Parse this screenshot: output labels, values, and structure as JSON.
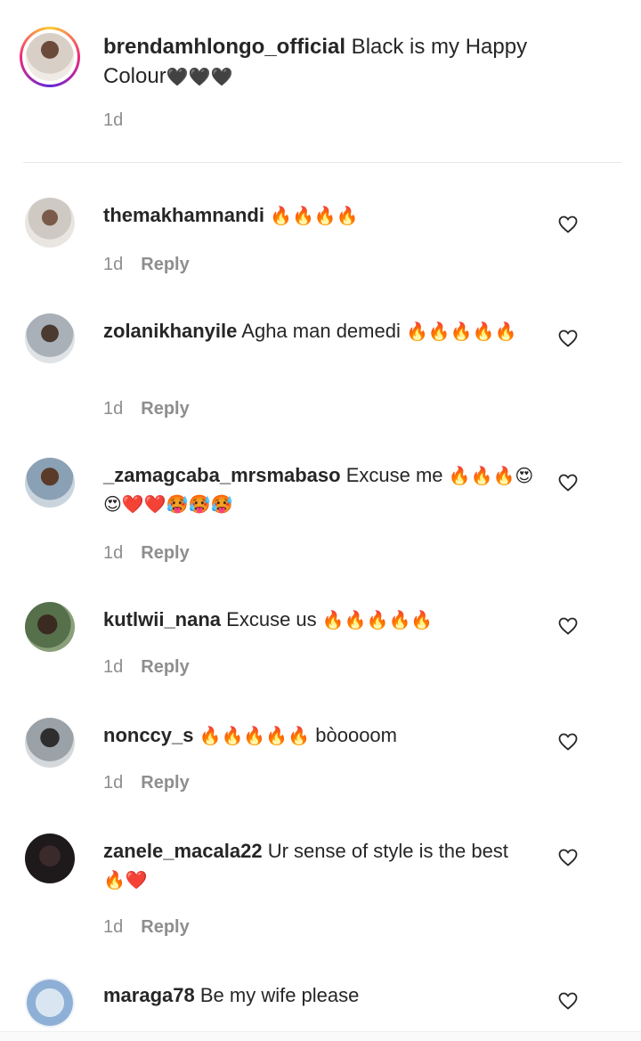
{
  "caption": {
    "username": "brendamhlongo_official",
    "text": " Black is my Happy Colour",
    "emoji": "🖤🖤🖤",
    "time": "1d"
  },
  "reply_label": "Reply",
  "comments": [
    {
      "username": "themakhamnandi",
      "text": " ",
      "emoji": "🔥🔥🔥🔥",
      "time": "1d"
    },
    {
      "username": "zolanikhanyile",
      "text": " Agha man demedi ",
      "emoji": "🔥🔥🔥🔥🔥",
      "time": "1d"
    },
    {
      "username": "_zamagcaba_mrsmabaso",
      "text": " Excuse me ",
      "emoji": "🔥🔥🔥😍😍❤️❤️🥵🥵🥵",
      "time": "1d"
    },
    {
      "username": "kutlwii_nana",
      "text": " Excuse us ",
      "emoji": "🔥🔥🔥🔥🔥",
      "time": "1d"
    },
    {
      "username": "nonccy_s",
      "text": " ",
      "emoji": "🔥🔥🔥🔥🔥",
      "text2": " bòoooom",
      "time": "1d"
    },
    {
      "username": "zanele_macala22",
      "text": " Ur sense of style is the best ",
      "emoji": "🔥❤️",
      "time": "1d"
    },
    {
      "username": "maraga78",
      "text": " Be my wife please",
      "emoji": "",
      "time": ""
    }
  ],
  "colors": {
    "accent": "#262626",
    "muted": "#8e8e8e",
    "divider": "#e6e6e6"
  }
}
